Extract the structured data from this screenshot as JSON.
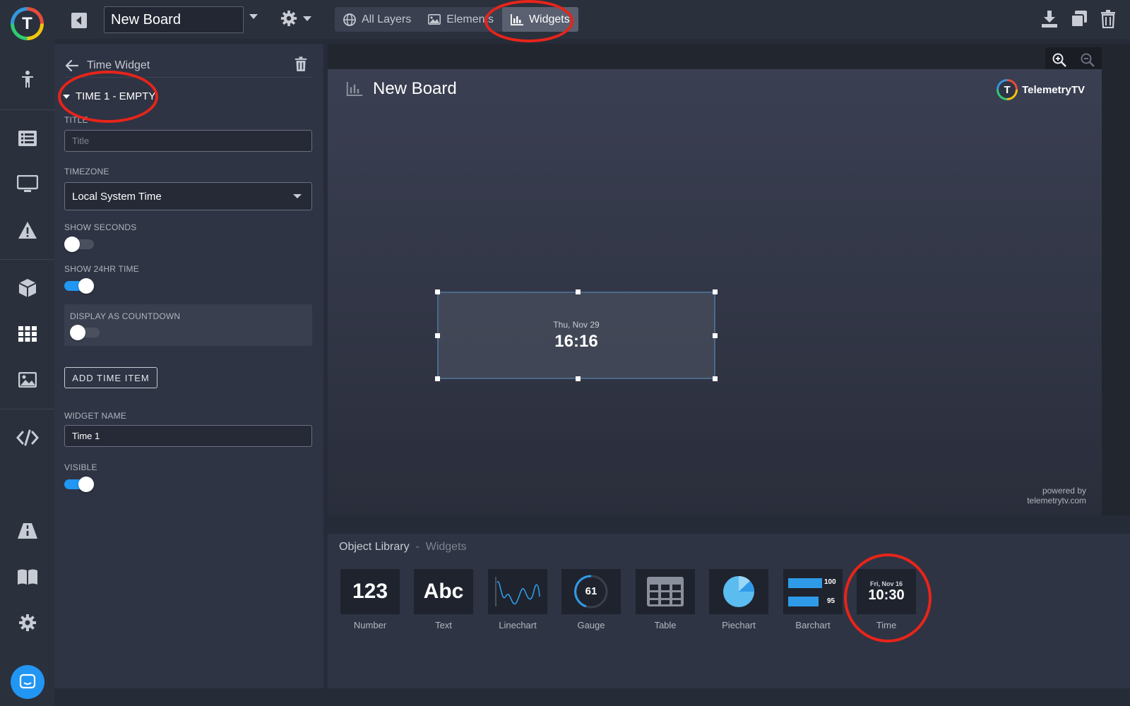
{
  "topbar": {
    "board_name": "New Board",
    "tabs": [
      {
        "label": "All Layers",
        "icon": "globe-icon"
      },
      {
        "label": "Elements",
        "icon": "image-icon"
      },
      {
        "label": "Widgets",
        "icon": "bar-chart-icon",
        "active": true
      }
    ]
  },
  "panel": {
    "header_title": "Time Widget",
    "section_title": "TIME 1 - EMPTY",
    "title_label": "TITLE",
    "title_placeholder": "Title",
    "timezone_label": "TIMEZONE",
    "timezone_value": "Local System Time",
    "show_seconds_label": "SHOW SECONDS",
    "show_seconds": false,
    "show_24hr_label": "SHOW 24HR TIME",
    "show_24hr": true,
    "countdown_label": "DISPLAY AS COUNTDOWN",
    "countdown": false,
    "add_button": "ADD TIME ITEM",
    "widget_name_label": "WIDGET NAME",
    "widget_name_value": "Time 1",
    "visible_label": "VISIBLE",
    "visible": true
  },
  "board": {
    "title": "New Board",
    "brand": "TelemetryTV",
    "brand_letter": "T",
    "widget_date": "Thu, Nov 29",
    "widget_time": "16:16",
    "powered_line1": "powered by",
    "powered_line2": "telemetrytv.com"
  },
  "library": {
    "title": "Object Library",
    "subtitle": "Widgets",
    "items": [
      {
        "label": "Number",
        "tile_text": "123"
      },
      {
        "label": "Text",
        "tile_text": "Abc"
      },
      {
        "label": "Linechart"
      },
      {
        "label": "Gauge",
        "tile_text": "61"
      },
      {
        "label": "Table"
      },
      {
        "label": "Piechart"
      },
      {
        "label": "Barchart",
        "bar_values": [
          "100",
          "95"
        ]
      },
      {
        "label": "Time",
        "tile_date": "Fri, Nov 16",
        "tile_time": "10:30"
      }
    ]
  },
  "colors": {
    "accent": "#2196f3",
    "annotation": "#e8241a"
  }
}
